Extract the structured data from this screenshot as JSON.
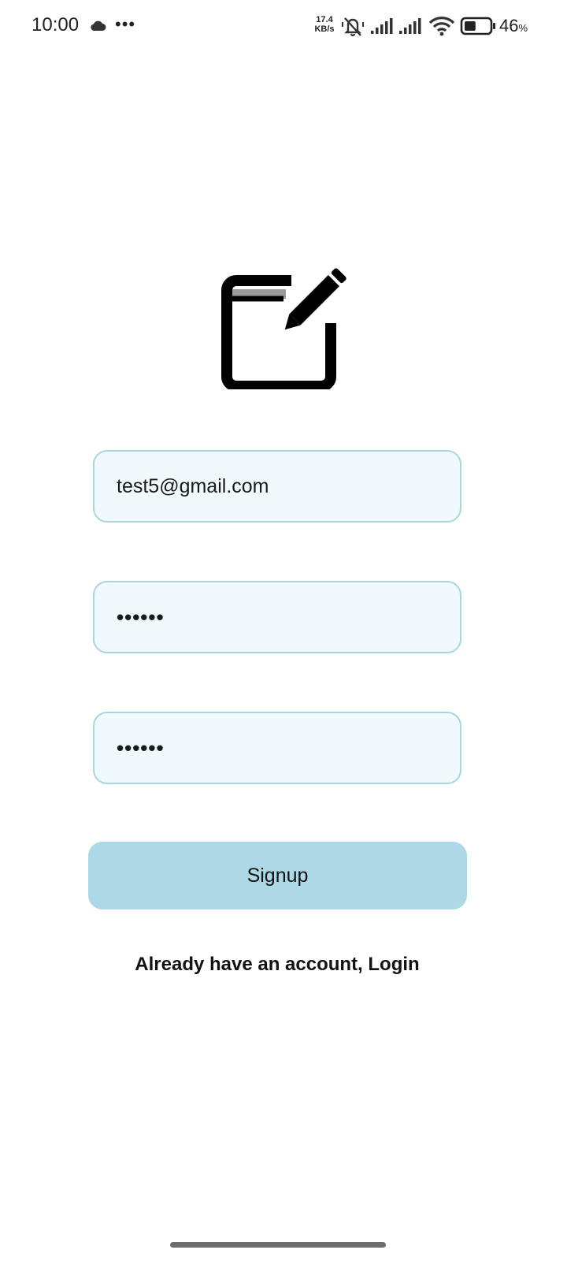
{
  "status_bar": {
    "time": "10:00",
    "more_indicator": "•••",
    "net_speed_value": "17.4",
    "net_speed_unit": "KB/s",
    "battery_percent": "46",
    "battery_percent_sign": "%",
    "battery_level": 0.46,
    "icons": [
      "cloud-icon",
      "muted-bell-icon",
      "signal-icon",
      "signal-icon",
      "wifi-icon",
      "battery-icon"
    ]
  },
  "logo": {
    "icon": "edit-note-icon"
  },
  "form": {
    "email_value": "test5@gmail.com",
    "password_value": "••••••",
    "confirm_password_value": "••••••"
  },
  "signup_button": {
    "label": "Signup"
  },
  "login_link": {
    "label": "Already have an account, Login"
  },
  "colors": {
    "field_border": "#a9d5e2",
    "field_background": "#f0f9fb",
    "button_background": "#add8e6"
  }
}
